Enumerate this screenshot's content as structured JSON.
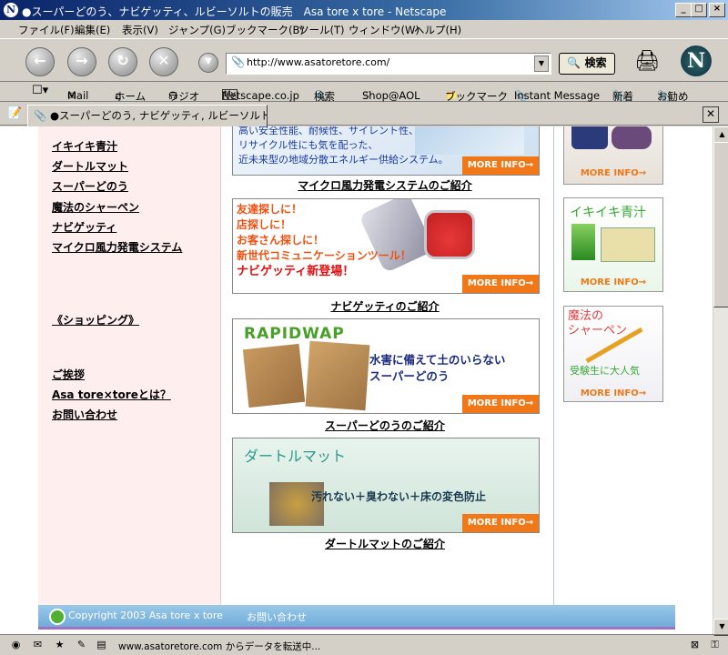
{
  "window": {
    "title": "●スーパーどのう、ナビゲッティ、ルビーソルトの販売　Asa tore x tore - Netscape",
    "app_icon": "N",
    "controls": [
      "_",
      "□",
      "×"
    ]
  },
  "menu": [
    "ファイル(F)",
    "編集(E)",
    "表示(V)",
    "ジャンプ(G)",
    "ブックマーク(B)",
    "ツール(T)",
    "ウィンドウ(W)",
    "ヘルプ(H)"
  ],
  "nav": {
    "url": "http://www.asatoretore.com/",
    "search_label": "検索",
    "logo": "N"
  },
  "personal_toolbar": [
    "Mail",
    "ホーム",
    "ラジオ",
    "Netscape.co.jp",
    "検索",
    "Shop@AOL",
    "ブックマーク",
    "Instant Message",
    "新着",
    "お勧め"
  ],
  "tab": {
    "title": "●スーパーどのう, ナビゲッティ, ルビーソルトの..."
  },
  "left_nav": {
    "links": [
      "イキイキ青汁",
      "ダートルマット",
      "スーパーどのう",
      "魔法のシャーペン",
      "ナビゲッティ",
      "マイクロ風力発電システム"
    ],
    "shopping": "《ショッピング》",
    "info_links": [
      "ご挨拶",
      "Asa tore×toreとは？",
      "お問い合わせ"
    ]
  },
  "main": {
    "more_info": "MORE INFO→",
    "wind": {
      "lines": [
        "高い安全性能、耐候性、サイレント性、",
        "リサイクル性にも気を配った、",
        "近未来型の地域分散エネルギー供給システム。"
      ],
      "caption": "マイクロ風力発電システムのご紹介"
    },
    "navi": {
      "lines": [
        "友達探しに！",
        "店探しに！",
        "お客さん探しに！",
        "新世代コミュニケーションツール！",
        "ナビゲッティ新登場！"
      ],
      "caption": "ナビゲッティのご紹介"
    },
    "donou": {
      "brand": "RAPIDWAP",
      "lines": [
        "水害に備えて土のいらない",
        "スーパーどのう"
      ],
      "caption": "スーパーどのうのご紹介"
    },
    "mat": {
      "title": "ダートルマット",
      "tagline": "汚れない＋臭わない＋床の変色防止",
      "caption": "ダートルマットのご紹介"
    }
  },
  "side": {
    "more_info": "MORE INFO→",
    "aojiru_title": "イキイキ青汁",
    "sharpen_title": [
      "魔法の",
      "シャーペン"
    ],
    "sharpen_sub": "受験生に大人気"
  },
  "footer": {
    "copyright": "Copyright 2003 Asa tore x tore",
    "contact": "お問い合わせ"
  },
  "status": {
    "text": "www.asatoretore.com からデータを転送中..."
  }
}
